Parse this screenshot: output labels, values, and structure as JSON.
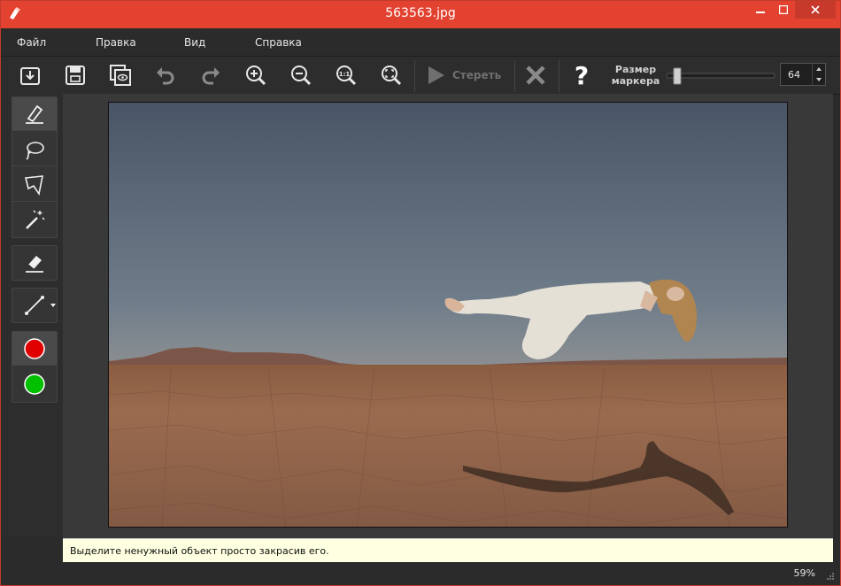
{
  "window": {
    "title": "563563.jpg"
  },
  "menu": [
    "Файл",
    "Правка",
    "Вид",
    "Справка"
  ],
  "toolbar": {
    "erase_label": "Стереть",
    "marker_size_label_line1": "Размер",
    "marker_size_label_line2": "маркера",
    "marker_size_value": "64"
  },
  "sidebar": {
    "colors": {
      "red": "#e00000",
      "green": "#00c000"
    }
  },
  "hint": {
    "text": "Выделите ненужный объект просто закрасив его."
  },
  "status": {
    "zoom": "59%"
  }
}
